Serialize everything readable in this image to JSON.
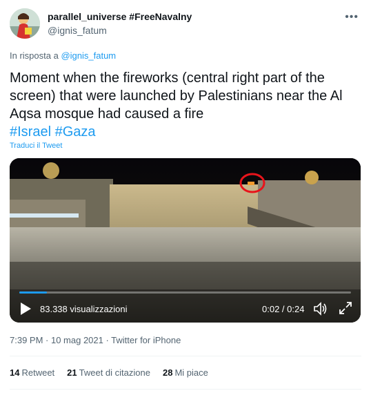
{
  "author": {
    "display_name": "parallel_universe #FreeNavalny",
    "handle": "@ignis_fatum",
    "avatar_icon": "avatar-photo"
  },
  "more_icon": "more-dots-icon",
  "reply": {
    "prefix": "In risposta a",
    "to": "@ignis_fatum"
  },
  "tweet": {
    "text": "Moment when the fireworks (central right part of the screen) that were launched by Palestinians near the Al Aqsa mosque had caused a fire",
    "hashtag_1": "#Israel",
    "hashtag_2": "#Gaza"
  },
  "translate_label": "Traduci il Tweet",
  "video": {
    "views": "83.338 visualizzazioni",
    "time": "0:02 / 0:24",
    "progress": 0.083,
    "accent": "#1d9bf0"
  },
  "meta": "7:39 PM · 10 mag 2021 · Twitter for iPhone",
  "stats": {
    "retweets_count": "14",
    "retweets_label": "Retweet",
    "quotes_count": "21",
    "quotes_label": "Tweet di citazione",
    "likes_count": "28",
    "likes_label": "Mi piace"
  }
}
